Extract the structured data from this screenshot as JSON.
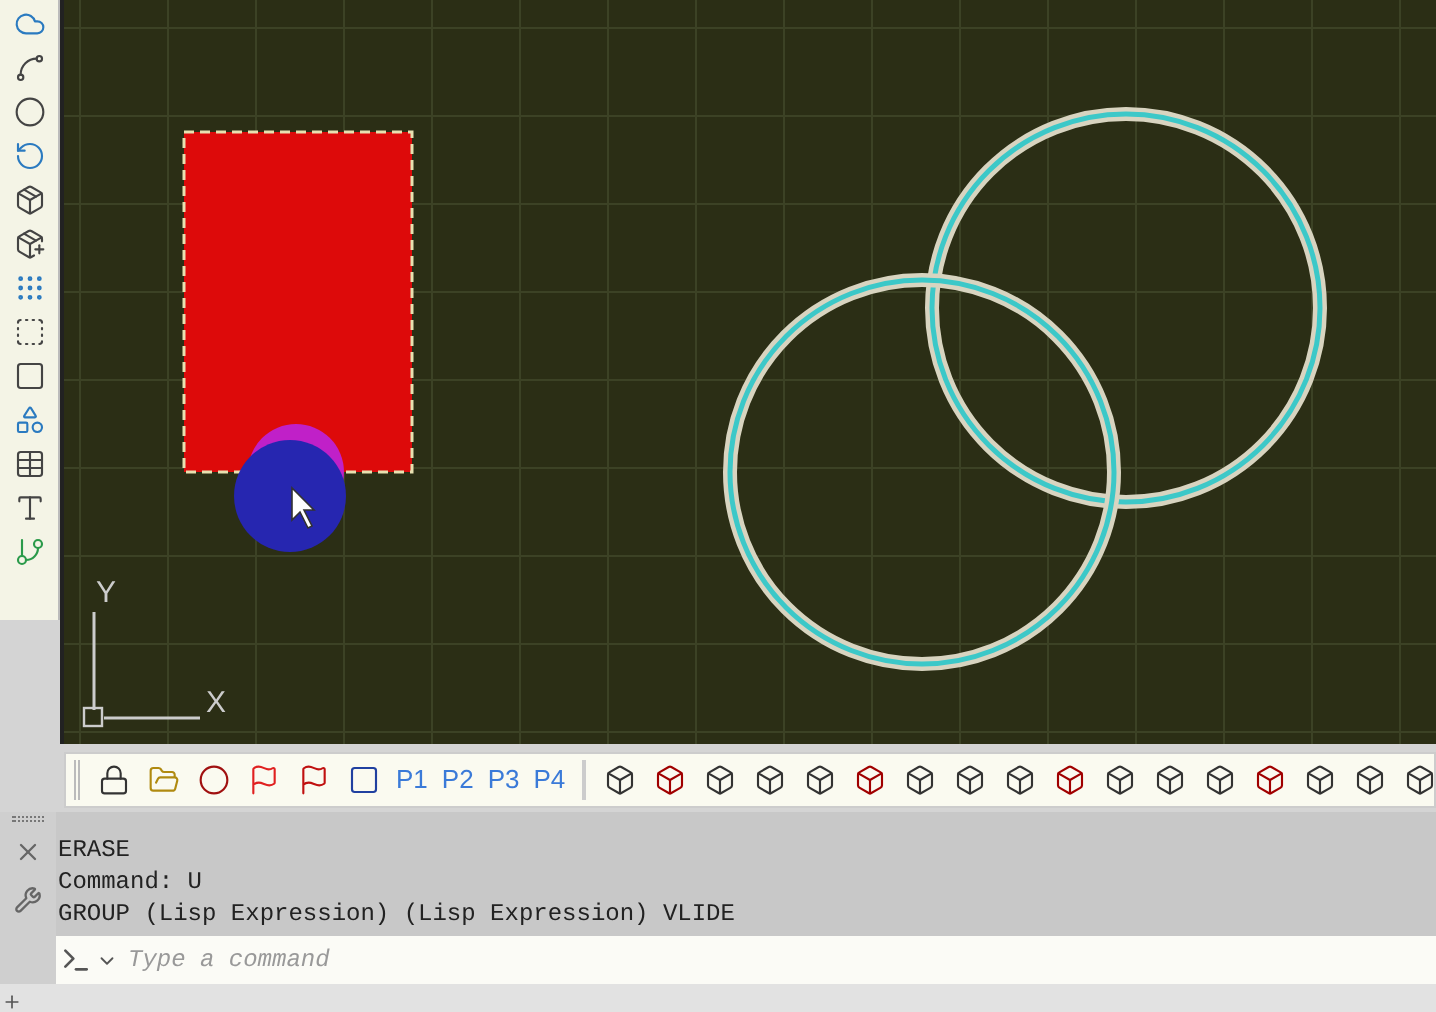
{
  "canvas": {
    "ucs": {
      "x_label": "X",
      "y_label": "Y"
    }
  },
  "toolbar": {
    "layout_buttons": [
      "P1",
      "P2",
      "P3",
      "P4"
    ]
  },
  "command_line": {
    "history": [
      "ERASE",
      "Command:  U",
      "GROUP (Lisp Expression) (Lisp Expression) VLIDE"
    ],
    "placeholder": "Type a command"
  }
}
